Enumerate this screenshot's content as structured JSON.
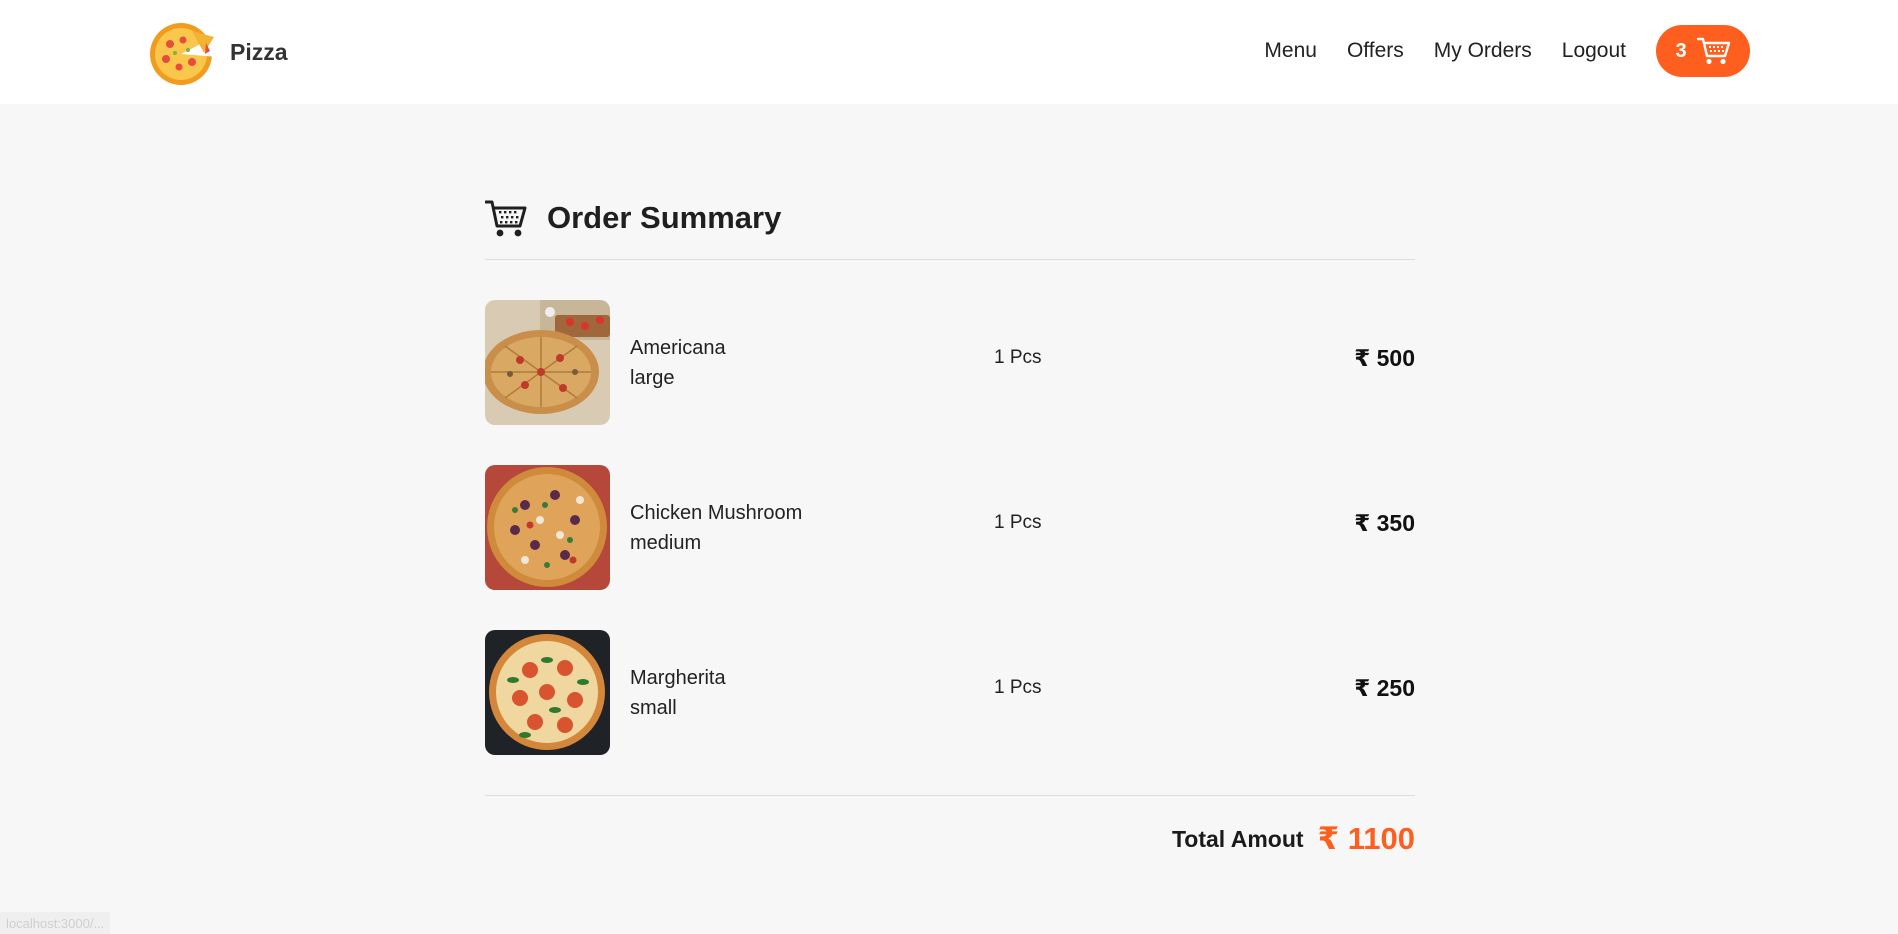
{
  "nav": {
    "brand": "Pizza",
    "links": [
      "Menu",
      "Offers",
      "My Orders",
      "Logout"
    ],
    "cart_count": "3"
  },
  "summary": {
    "title": "Order Summary",
    "items": [
      {
        "name": "Americana",
        "size": "large",
        "qty": "1 Pcs",
        "price": "₹ 500"
      },
      {
        "name": "Chicken Mushroom",
        "size": "medium",
        "qty": "1 Pcs",
        "price": "₹ 350"
      },
      {
        "name": "Margherita",
        "size": "small",
        "qty": "1 Pcs",
        "price": "₹ 250"
      }
    ],
    "total_label": "Total Amout",
    "total_amount": "₹ 1100"
  },
  "status_bar": "localhost:3000/...",
  "colors": {
    "accent": "#fe5f1e",
    "background": "#f7f7f7",
    "navbar": "#ffffff"
  },
  "icons": {
    "brand": "pizza-logo-icon",
    "cart": "cart-icon"
  }
}
